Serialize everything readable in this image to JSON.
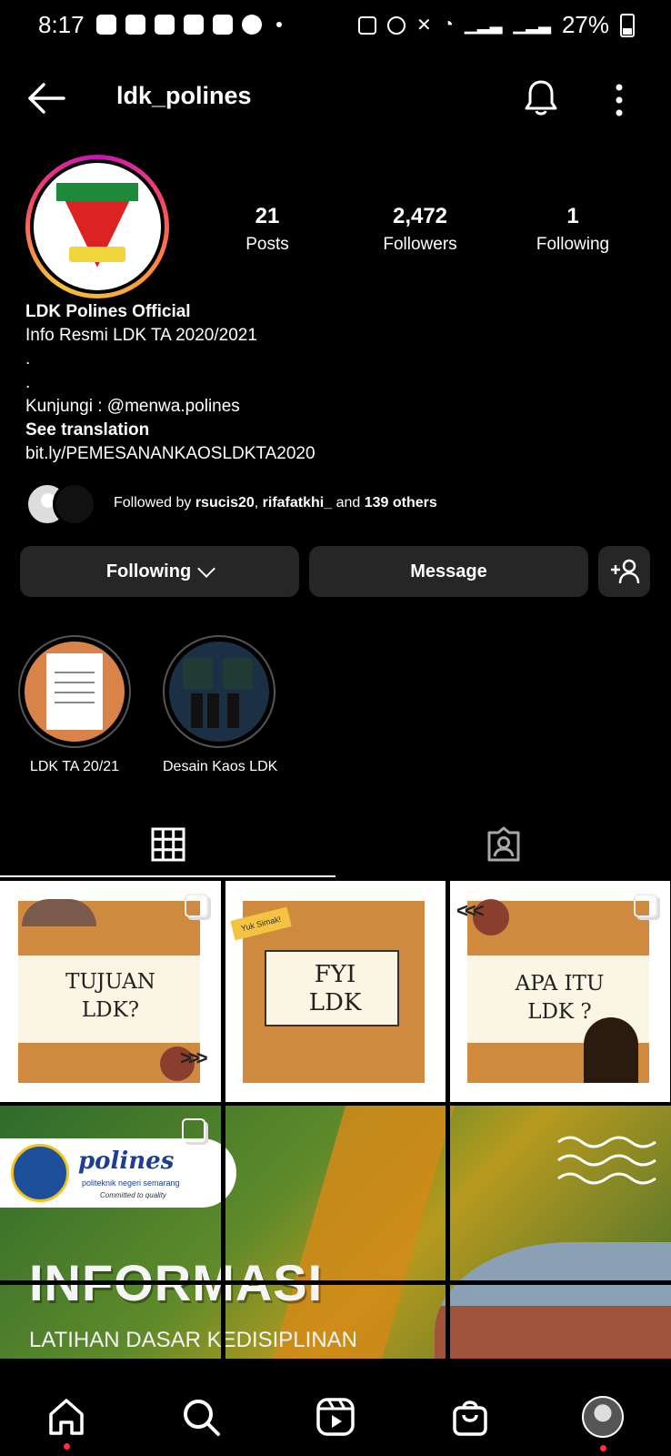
{
  "status_bar": {
    "time": "8:17",
    "battery": "27%"
  },
  "header": {
    "username": "ldk_polines"
  },
  "profile": {
    "stats": [
      {
        "value": "21",
        "label": "Posts"
      },
      {
        "value": "2,472",
        "label": "Followers"
      },
      {
        "value": "1",
        "label": "Following"
      }
    ],
    "display_name": "LDK Polines Official",
    "bio_lines": [
      "Info Resmi LDK TA 2020/2021",
      ".",
      ".",
      "Kunjungi : @menwa.polines"
    ],
    "see_translation": "See translation",
    "link": "bit.ly/PEMESANANKAOSLDKTA2020",
    "followed_by": {
      "prefix": "Followed by ",
      "user1": "rsucis20",
      "sep": ", ",
      "user2": "rifafatkhi_",
      "and": " and ",
      "others": "139 others"
    }
  },
  "actions": {
    "following_label": "Following",
    "message_label": "Message"
  },
  "highlights": [
    {
      "label": "LDK TA 20/21"
    },
    {
      "label": "Desain Kaos LDK"
    }
  ],
  "posts": [
    {
      "title_line1": "TUJUAN",
      "title_line2": "LDK?"
    },
    {
      "tag": "Yuk Simak!",
      "title_line1": "FYI",
      "title_line2": "LDK"
    },
    {
      "title_line1": "APA ITU",
      "title_line2": "LDK ?"
    }
  ],
  "big_post": {
    "logo_word": "polines",
    "logo_sub": "politeknik negeri semarang",
    "logo_tagline": "Committed to quality",
    "title": "INFORMASI",
    "subtitle": "LATIHAN DASAR  KEDISIPLINAN"
  },
  "colors": {
    "background": "#000000",
    "button": "#262626",
    "notification_dot": "#ff3040"
  }
}
